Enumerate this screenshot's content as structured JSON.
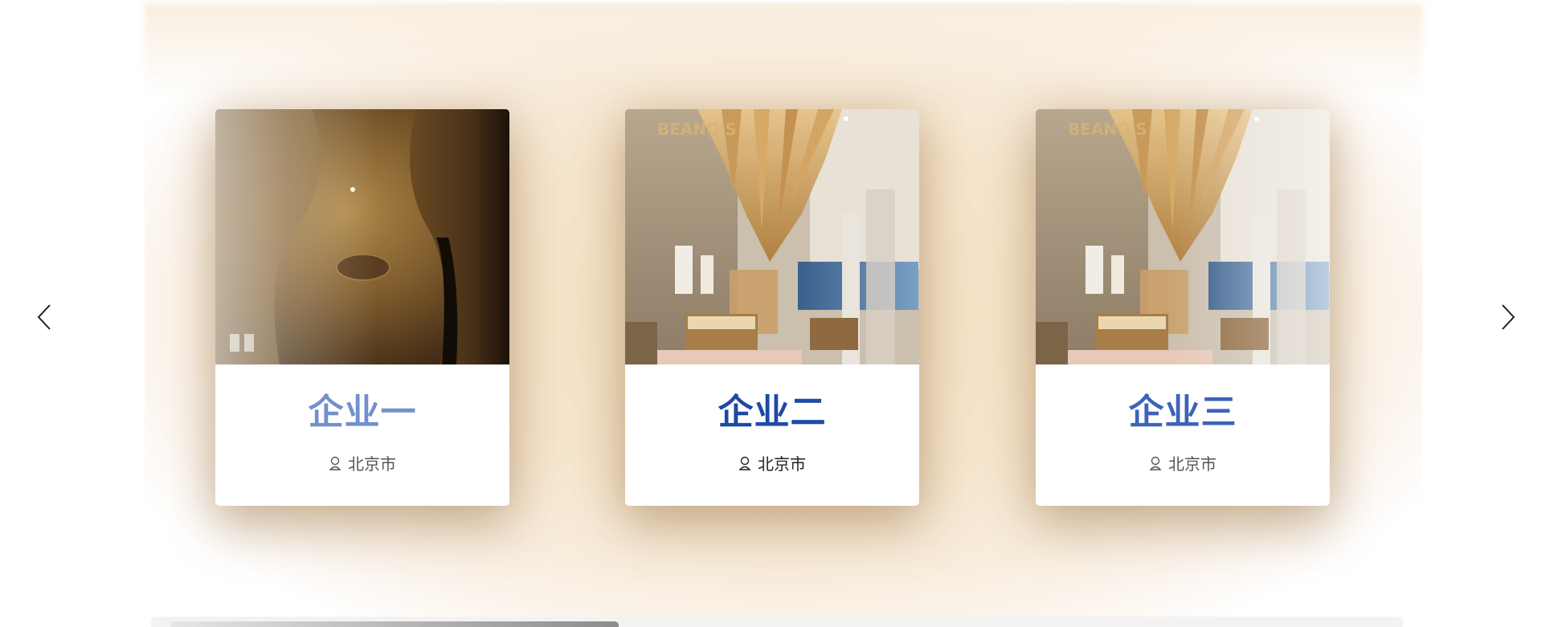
{
  "carousel": {
    "cards": [
      {
        "title": "企业一",
        "location": "北京市",
        "photo": "interior-wood-photo"
      },
      {
        "title": "企业二",
        "location": "北京市",
        "photo": "bakery-interior-photo"
      },
      {
        "title": "企业三",
        "location": "北京市",
        "photo": "bakery-interior-photo"
      }
    ],
    "prev_icon": "chevron-left-icon",
    "next_icon": "chevron-right-icon",
    "location_icon": "map-pin-icon"
  },
  "colors": {
    "background_glow": "#f3dfc2",
    "title_active": "#1d4aa6",
    "title_faded": "#7290cc",
    "text": "#555555"
  }
}
